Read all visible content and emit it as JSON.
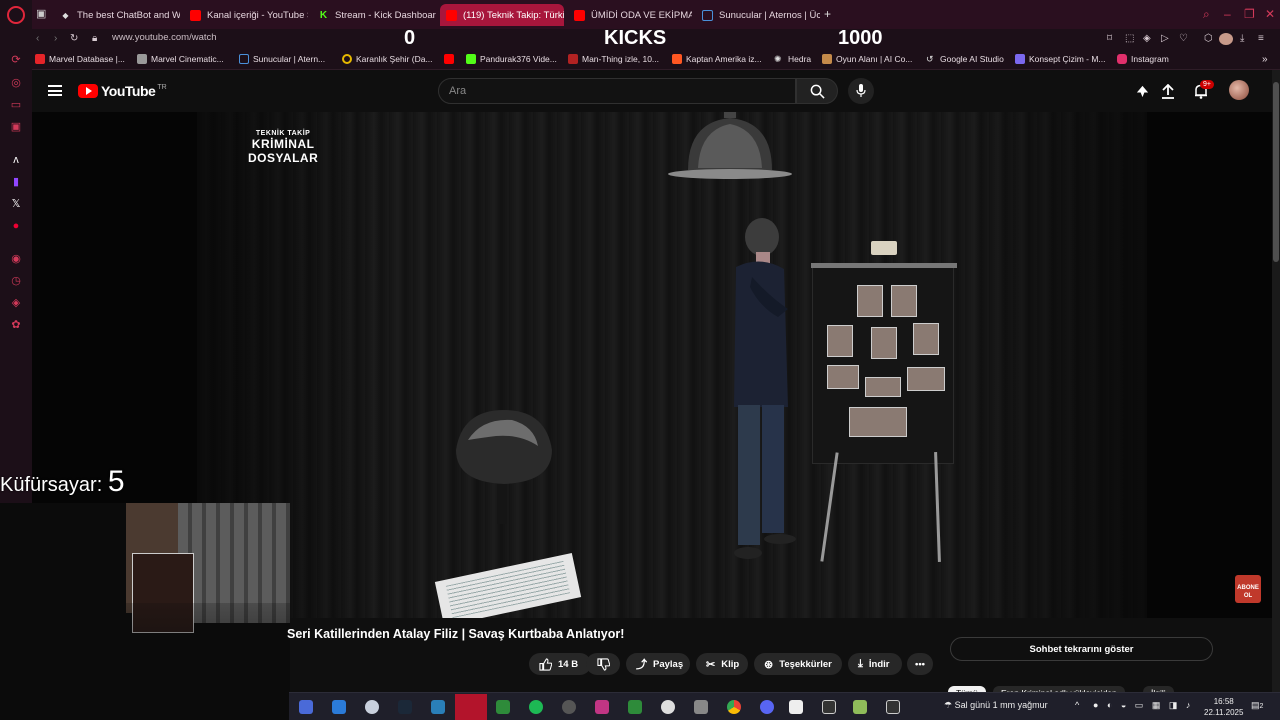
{
  "browser": {
    "tabs": [
      {
        "label": "The best ChatBot and Wi",
        "icon": "chatbot-icon",
        "color": "#dddddd"
      },
      {
        "label": "Kanal içeriği - YouTube S",
        "icon": "youtube-icon",
        "color": "#ff0000"
      },
      {
        "label": "Stream - Kick Dashboard",
        "icon": "kick-icon",
        "color": "#53fc18"
      },
      {
        "label": "(119) Teknik Takip: Türkiy",
        "icon": "youtube-icon",
        "color": "#ff0000"
      },
      {
        "label": "ÜMİDİ ODA VE EKİPMAN",
        "icon": "youtube-icon",
        "color": "#ff0000"
      },
      {
        "label": "Sunucular | Aternos | Ücr",
        "icon": "aternos-icon",
        "color": "#4a90d9"
      }
    ],
    "url": "www.youtube.com/watch",
    "kick_overlay": {
      "left": "0",
      "center": "KICKS",
      "right": "1000"
    },
    "bookmarks": [
      {
        "label": "Marvel Database |...",
        "color": "#e62429"
      },
      {
        "label": "Marvel Cinematic...",
        "color": "#999999"
      },
      {
        "label": "Sunucular | Atern...",
        "color": "#4a90d9"
      },
      {
        "label": "Karanlık Şehir (Da...",
        "color": "#e6b800"
      },
      {
        "label": "",
        "color": "#ff0000"
      },
      {
        "label": "Pandurak376 Vide...",
        "color": "#53fc18"
      },
      {
        "label": "Man-Thing izle, 10...",
        "color": "#b22222"
      },
      {
        "label": "Kaptan Amerika iz...",
        "color": "#ff5722"
      },
      {
        "label": "Hedra",
        "color": "#dddddd"
      },
      {
        "label": "Oyun Alanı | AI Co...",
        "color": "#c48a4a"
      },
      {
        "label": "Google AI Studio",
        "color": "#dddddd"
      },
      {
        "label": "Konsept Çizim - M...",
        "color": "#7b68ee"
      },
      {
        "label": "Instagram",
        "color": "#e1306c"
      }
    ]
  },
  "youtube": {
    "logo_text": "YouTube",
    "region": "TR",
    "search_placeholder": "Ara",
    "notification_count": "9+"
  },
  "video": {
    "channel_logo_line1": "TEKNİK TAKİP",
    "channel_logo_line2": "KRİMİNAL",
    "channel_logo_line3": "DOSYALAR",
    "subscribe_badge": "ABONE OL"
  },
  "overlay": {
    "counter_label": "Küfürsayar:",
    "counter_value": "5"
  },
  "below_video": {
    "title": "Seri Katillerinden Atalay Filiz | Savaş Kurtbaba Anlatıyor!",
    "like_count": "14 B",
    "share_label": "Paylaş",
    "clip_label": "Klip",
    "thanks_label": "Teşekkürler",
    "download_label": "İndir",
    "chat_replay_label": "Sohbet tekrarını göster",
    "chips": [
      "Tümü",
      "Eren Kriminal adlı yükleyiciden",
      "İlgili"
    ]
  },
  "taskbar": {
    "weather": "Sal günü 1 mm yağmur",
    "time": "16:58",
    "date": "22.11.2025",
    "notifications": "2"
  }
}
